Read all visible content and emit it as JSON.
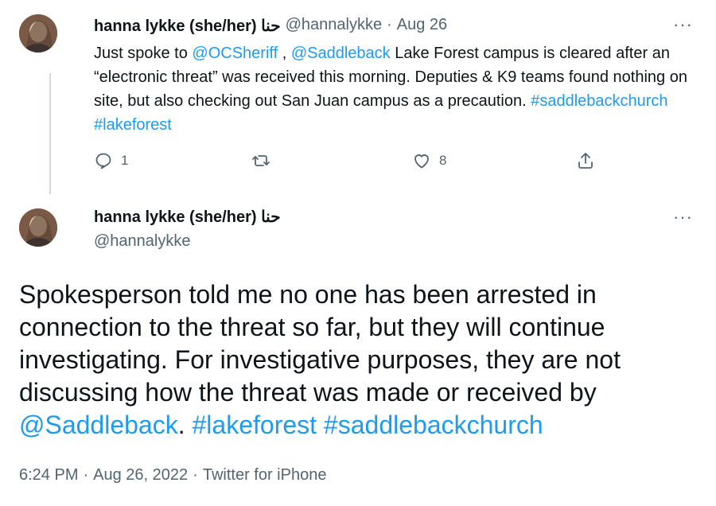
{
  "tweet1": {
    "display_name": "hanna lykke (she/her) حنا",
    "handle": "@hannalykke",
    "separator": "·",
    "date": "Aug 26",
    "more": "···",
    "text_parts": [
      {
        "text": "Just spoke to ",
        "link": false
      },
      {
        "text": "@OCSheriff",
        "link": true
      },
      {
        "text": " , ",
        "link": false
      },
      {
        "text": "@Saddleback",
        "link": true
      },
      {
        "text": " Lake Forest campus is cleared after an “electronic threat” was received this morning. Deputies & K9 teams found nothing on site, but also checking out San Juan campus as a precaution. ",
        "link": false
      },
      {
        "text": "#saddlebackchurch",
        "link": true
      },
      {
        "text": " ",
        "link": false
      },
      {
        "text": "#lakeforest",
        "link": true
      }
    ],
    "actions": {
      "reply_count": "1",
      "retweet_count": "",
      "like_count": "8"
    }
  },
  "tweet2": {
    "display_name": "hanna lykke (she/her) حنا",
    "handle": "@hannalykke",
    "more": "···",
    "text_parts": [
      {
        "text": "Spokesperson told me no one has been arrested in connection to the threat so far, but they will continue investigating. For investigative purposes, they are not discussing how the threat was made or received by ",
        "link": false
      },
      {
        "text": "@Saddleback",
        "link": true
      },
      {
        "text": ". ",
        "link": false
      },
      {
        "text": "#lakeforest",
        "link": true
      },
      {
        "text": " ",
        "link": false
      },
      {
        "text": "#saddlebackchurch",
        "link": true
      }
    ],
    "time": "6:24 PM",
    "date": "Aug 26, 2022",
    "source": "Twitter for iPhone",
    "separator": "·"
  },
  "colors": {
    "link": "#1d9bf0",
    "text": "#0f1419",
    "muted": "#536471",
    "thread_line": "#cfd9de"
  },
  "icons": [
    "reply-icon",
    "retweet-icon",
    "like-icon",
    "share-icon",
    "more-icon"
  ]
}
